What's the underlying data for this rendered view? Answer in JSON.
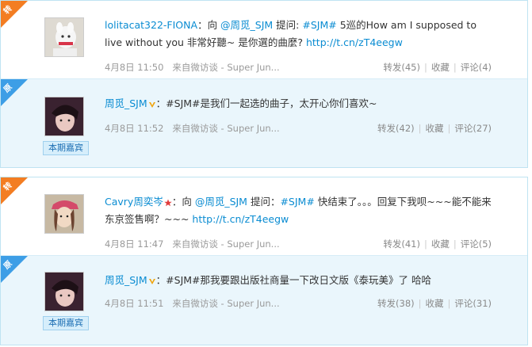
{
  "tags": {
    "forward": "转",
    "original": "原"
  },
  "badge": "本期嘉宾",
  "colors": {
    "link": "#0a8cd2",
    "accent_orange": "#f37d22",
    "accent_blue": "#3d9ee6"
  },
  "cards": [
    {
      "question": {
        "user": "lolitacat322-FIONA",
        "text_before": "：向 ",
        "mention": "@周觅_SJM",
        "text_mid": " 提问: ",
        "topic": "#SJM#",
        "text_after": " 5巡的How am I supposed to live without you 非常好聽~ 是你選的曲麼? ",
        "url": "http://t.cn/zT4eegw",
        "time": "4月8日 11:50",
        "source": "来自微访谈 - Super Jun...",
        "forward": "转发(45)",
        "favorite": "收藏",
        "comment": "评论(4)"
      },
      "answer": {
        "user": "周觅_SJM",
        "text": "：#SJM#是我们一起选的曲子，太开心你们喜欢~",
        "time": "4月8日 11:52",
        "source": "来自微访谈 - Super Jun...",
        "forward": "转发(42)",
        "favorite": "收藏",
        "comment": "评论(27)"
      }
    },
    {
      "question": {
        "user": "Cavry周奕岑",
        "text_before": "：向 ",
        "mention": "@周觅_SJM",
        "text_mid": " 提问：",
        "topic": "#SJM#",
        "text_after": " 快结束了。。。回复下我呗~~~能不能来东京签售啊？~~~ ",
        "url": "http://t.cn/zT4eegw",
        "time": "4月8日 11:47",
        "source": "来自微访谈 - Super Jun...",
        "forward": "转发(41)",
        "favorite": "收藏",
        "comment": "评论(5)"
      },
      "answer": {
        "user": "周觅_SJM",
        "text": "：#SJM#那我要跟出版社商量一下改日文版《泰玩美》了 哈哈",
        "time": "4月8日 11:51",
        "source": "来自微访谈 - Super Jun...",
        "forward": "转发(38)",
        "favorite": "收藏",
        "comment": "评论(31)"
      }
    }
  ]
}
